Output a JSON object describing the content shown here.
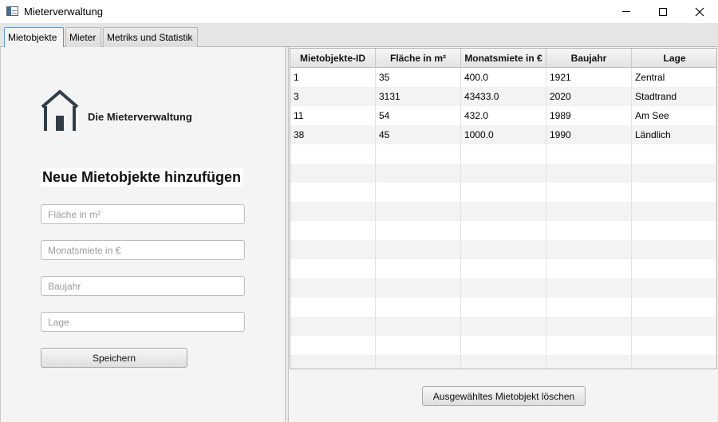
{
  "window": {
    "title": "Mieterverwaltung",
    "icons": [
      "app-icon",
      "minimize-icon",
      "maximize-icon",
      "close-icon"
    ]
  },
  "tabs": [
    {
      "label": "Mietobjekte",
      "active": true
    },
    {
      "label": "Mieter",
      "active": false
    },
    {
      "label": "Metriks und Statistik",
      "active": false
    }
  ],
  "form": {
    "brand": "Die Mieterverwaltung",
    "heading": "Neue Mietobjekte hinzufügen",
    "fields": [
      {
        "placeholder": "Fläche in m²",
        "value": ""
      },
      {
        "placeholder": "Monatsmiete in €",
        "value": ""
      },
      {
        "placeholder": "Baujahr",
        "value": ""
      },
      {
        "placeholder": "Lage",
        "value": ""
      }
    ],
    "save_label": "Speichern"
  },
  "table": {
    "columns": [
      "Mietobjekte-ID",
      "Fläche in m²",
      "Monatsmiete in €",
      "Baujahr",
      "Lage"
    ],
    "rows": [
      [
        "1",
        "35",
        "400.0",
        "1921",
        "Zentral"
      ],
      [
        "3",
        "3131",
        "43433.0",
        "2020",
        "Stadtrand"
      ],
      [
        "11",
        "54",
        "432.0",
        "1989",
        "Am See"
      ],
      [
        "38",
        "45",
        "1000.0",
        "1990",
        "Ländlich"
      ]
    ]
  },
  "delete_label": "Ausgewähltes Mietobjekt löschen",
  "colors": {
    "accent": "#5a9ad5",
    "house_icon": "#2f3e46"
  }
}
